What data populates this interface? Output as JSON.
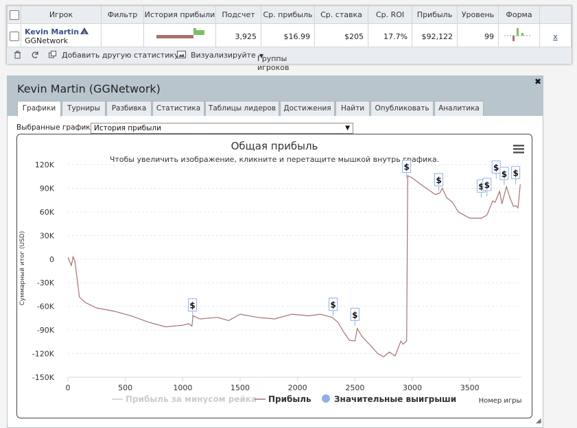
{
  "stats": {
    "headers": [
      "Игрок",
      "Фильтр",
      "История прибыли",
      "Подсчет",
      "Ср. прибыль",
      "Ср. ставка",
      "Ср. ROI",
      "Прибыль",
      "Уровень",
      "Форма"
    ],
    "row": {
      "player": "Kevin Martin",
      "network": "GGNetwork",
      "count": "3,925",
      "avg_profit": "$16.99",
      "avg_stake": "$205",
      "avg_roi": "17.7%",
      "profit": "$92,122",
      "level": "99",
      "remove": "x"
    },
    "toolbar": {
      "add_stat": "Добавить другую статистику",
      "visualize": "Визуализируйте",
      "groups": "Группы игроков"
    }
  },
  "panel": {
    "title": "Kevin Martin (GGNetwork)",
    "tabs": [
      "Графики",
      "Турниры",
      "Разбивка",
      "Статистика",
      "Таблицы лидеров",
      "Достижения",
      "Найти",
      "Опубликовать",
      "Аналитика"
    ],
    "selected_label": "Выбранные графики:",
    "selected_value": "История прибыли"
  },
  "colors": {
    "profit_line": "#a86f6f",
    "win_marker": "#8fb0e6",
    "header_bg": "#b8c5cd"
  },
  "chart_data": {
    "type": "line",
    "title": "Общая прибыль",
    "subtitle": "Чтобы увеличить изображение, кликните и перетащите мышкой внутрь графика.",
    "ylabel": "Суммарный итог (USD)",
    "xlabel": "Номер игры",
    "ylim": [
      -150000,
      120000
    ],
    "xlim": [
      0,
      3950
    ],
    "y_ticks": [
      "120K",
      "90K",
      "60K",
      "30K",
      "0",
      "-30K",
      "-60K",
      "-90K",
      "-120K",
      "-150K"
    ],
    "x_ticks": [
      "0",
      "500",
      "1000",
      "1500",
      "2000",
      "2500",
      "3000",
      "3500"
    ],
    "legend": [
      "Прибыль за минусом рейка",
      "Прибыль",
      "Значительные выигрыши"
    ],
    "legend_position": "bottom",
    "series": [
      {
        "name": "Прибыль",
        "x": [
          0,
          30,
          45,
          60,
          80,
          100,
          150,
          250,
          400,
          550,
          700,
          850,
          1000,
          1050,
          1080,
          1090,
          1150,
          1300,
          1400,
          1500,
          1650,
          1800,
          1950,
          2100,
          2200,
          2300,
          2350,
          2400,
          2450,
          2500,
          2520,
          2560,
          2650,
          2700,
          2750,
          2800,
          2850,
          2900,
          2920,
          2950,
          2960,
          3000,
          3100,
          3200,
          3240,
          3260,
          3300,
          3350,
          3400,
          3500,
          3600,
          3650,
          3700,
          3720,
          3760,
          3780,
          3820,
          3850,
          3880,
          3900,
          3920,
          3940
        ],
        "y": [
          2000,
          -8000,
          3000,
          -2000,
          -25000,
          -48000,
          -55000,
          -62000,
          -66000,
          -72000,
          -80000,
          -86000,
          -84000,
          -82000,
          -85000,
          -72000,
          -76000,
          -74000,
          -78000,
          -70000,
          -74000,
          -76000,
          -70000,
          -72000,
          -70000,
          -74000,
          -80000,
          -92000,
          -103000,
          -104000,
          -88000,
          -98000,
          -112000,
          -120000,
          -124000,
          -118000,
          -123000,
          -104000,
          -108000,
          -104000,
          106000,
          103000,
          92000,
          82000,
          84000,
          90000,
          78000,
          72000,
          60000,
          52000,
          52000,
          56000,
          74000,
          72000,
          86000,
          70000,
          92000,
          78000,
          67000,
          68000,
          65000,
          95000
        ]
      },
      {
        "name": "Значительные выигрыши",
        "x": [
          1085,
          2310,
          2500,
          2950,
          3230,
          3600,
          3650,
          3730,
          3800,
          3900
        ],
        "y": [
          -73000,
          -72000,
          -85000,
          103000,
          86000,
          78000,
          80000,
          102000,
          94000,
          95000
        ],
        "label": "$"
      }
    ]
  }
}
